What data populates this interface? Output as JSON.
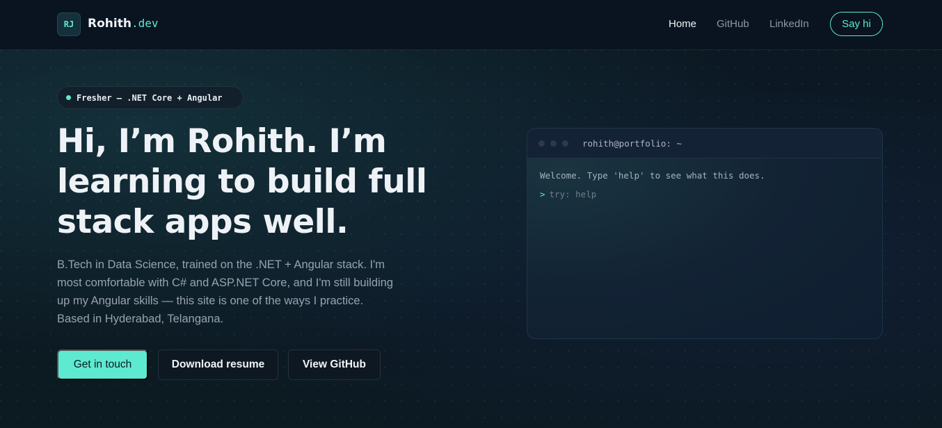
{
  "header": {
    "logo_initials": "RJ",
    "brand_name": "Rohith",
    "brand_tld": ".dev",
    "nav": [
      {
        "label": "Home",
        "active": true
      },
      {
        "label": "GitHub",
        "active": false
      },
      {
        "label": "LinkedIn",
        "active": false
      }
    ],
    "cta_label": "Say hi"
  },
  "hero": {
    "badge": "Fresher — .NET Core + Angular",
    "headline": "Hi, I’m Rohith. I’m learning to build full stack apps well.",
    "intro": "B.Tech in Data Science, trained on the .NET + Angular stack. I'm most comfortable with C# and ASP.NET Core, and I'm still building up my Angular skills — this site is one of the ways I practice. Based in Hyderabad, Telangana.",
    "buttons": {
      "contact": "Get in touch",
      "resume": "Download resume",
      "github": "View GitHub"
    }
  },
  "terminal": {
    "title": "rohith@portfolio: ~",
    "welcome": "Welcome. Type 'help' to see what this does.",
    "prompt_symbol": ">",
    "placeholder": "try: help"
  },
  "colors": {
    "accent": "#5ee9d1",
    "background": "#0d1a22"
  }
}
